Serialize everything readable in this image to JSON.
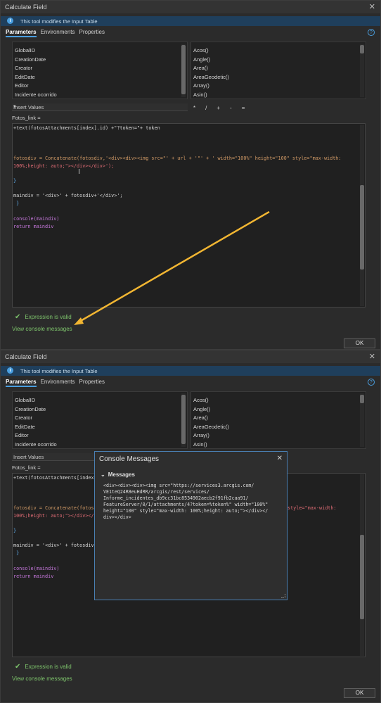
{
  "dialog": {
    "title": "Calculate Field",
    "info_text": "This tool modifies the Input Table",
    "tabs": [
      "Parameters",
      "Environments",
      "Properties"
    ],
    "fields": [
      "GlobalID",
      "CreationDate",
      "Creator",
      "EditDate",
      "Editor",
      "Incidente ocorrido"
    ],
    "functions": [
      "Acos()",
      "Angle()",
      "Area()",
      "AreaGeodetic()",
      "Array()",
      "Asin()"
    ],
    "insert_values": "Insert Values",
    "operators": [
      "*",
      "/",
      "+",
      "-",
      "="
    ],
    "field_label": "Fotos_link =",
    "valid_text": "Expression is valid",
    "console_link": "View console messages",
    "ok_label": "OK"
  },
  "code": {
    "line1": "+text(fotosAttachments[index].id) +\"?token=\"+ token",
    "line2a": "fotosdiv = Concatenate(fotosdiv,'<div><div><img src=\"' + url + '\"' + ' width=\"100%\" height=\"100\" style=\"max-width:",
    "line2b": "100%;height: auto;\"></div></div>');",
    "brace1": "}",
    "line3": "maindiv = '<div>' + fotosdiv+'</div>';",
    "brace2": " }",
    "line4": "console(maindiv)",
    "line5": "return maindiv",
    "line1_cut": "+text(fotosAttachments[index",
    "line2a_cut": "fotosdiv = Concatenate(fotos",
    "line2a_tail": "style=\"max-width:",
    "line2b_cut": "100%;height: auto;\"></div></d",
    "line3_cut": "maindiv = '<div>' + fotosdiv"
  },
  "console": {
    "title": "Console Messages",
    "section": "Messages",
    "lines": [
      "<div><div><div><img src=\"https://services3.arcgis.com/",
      "VE1teQ24R8euHdRR/arcgis/rest/services/",
      "Informe_incidentes_db9cc31bc8534902aecb2f91fb2caa91/",
      "FeatureServer/0/1/attachments/4?token=%token%\" width=\"100%\"",
      "height=\"100\" style=\"max-width: 100%;height: auto;\"></div></",
      "div></div>"
    ]
  },
  "colors": {
    "accent": "#4a9fe0",
    "valid": "#7dc36b",
    "arrow": "#f2b632"
  }
}
